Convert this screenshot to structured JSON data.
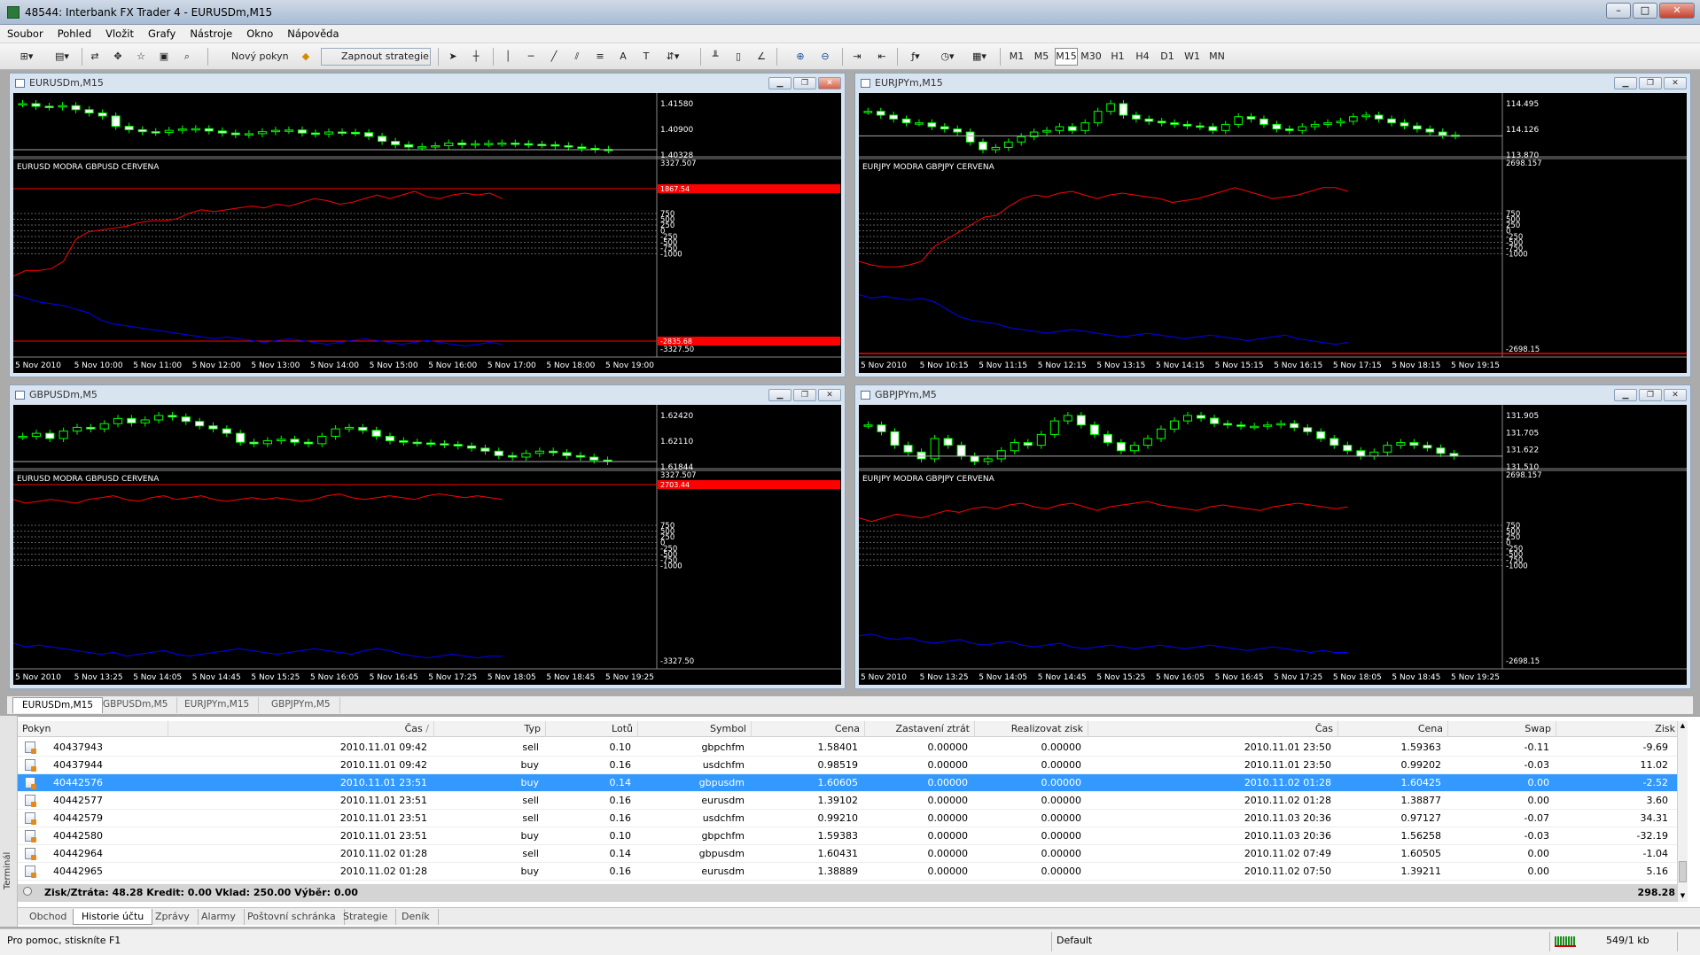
{
  "window": {
    "title": "48544: Interbank FX Trader 4 - EURUSDm,M15",
    "controls": [
      "–",
      "□",
      "✕"
    ]
  },
  "menu": [
    "Soubor",
    "Pohled",
    "Vložit",
    "Grafy",
    "Nástroje",
    "Okno",
    "Nápověda"
  ],
  "toolbar": {
    "new_order": "Nový pokyn",
    "expert": "Zapnout strategie",
    "periods": [
      "M1",
      "M5",
      "M15",
      "M30",
      "H1",
      "H4",
      "D1",
      "W1",
      "MN"
    ],
    "active_period": "M15"
  },
  "charts": [
    {
      "title": "EURUSDm,M15",
      "price_ticks": [
        "1.41580",
        "1.40900",
        "1.40328"
      ],
      "indicator_label": "EURUSD MODRA    GBPUSD CERVENA",
      "indicator_ticks": [
        "3327.507",
        "750",
        "500",
        "250",
        "0",
        "-250",
        "-500",
        "-750",
        "-1000",
        "-3327.50"
      ],
      "red_marker": "1867.54",
      "blue_marker": "-2835.68",
      "time_labels": [
        "5 Nov 2010",
        "5 Nov 10:00",
        "5 Nov 11:00",
        "5 Nov 12:00",
        "5 Nov 13:00",
        "5 Nov 14:00",
        "5 Nov 15:00",
        "5 Nov 16:00",
        "5 Nov 17:00",
        "5 Nov 18:00",
        "5 Nov 19:00"
      ],
      "candles": [
        1.4178,
        1.417,
        1.4168,
        1.4172,
        1.416,
        1.415,
        1.4141,
        1.411,
        1.41,
        1.4094,
        1.4092,
        1.4098,
        1.4102,
        1.4103,
        1.4096,
        1.409,
        1.4085,
        1.4088,
        1.4094,
        1.4098,
        1.4099,
        1.409,
        1.4087,
        1.4093,
        1.4092,
        1.4091,
        1.408,
        1.4065,
        1.4055,
        1.4048,
        1.4049,
        1.4052,
        1.406,
        1.4055,
        1.4058,
        1.4059,
        1.406,
        1.4058,
        1.4056,
        1.4055,
        1.4052,
        1.4048,
        1.4044,
        1.4041,
        1.404
      ],
      "red_line": [
        0.42,
        0.45,
        0.45,
        0.46,
        0.5,
        0.62,
        0.66,
        0.67,
        0.68,
        0.69,
        0.71,
        0.72,
        0.72,
        0.73,
        0.76,
        0.78,
        0.77,
        0.78,
        0.79,
        0.8,
        0.79,
        0.81,
        0.8,
        0.82,
        0.84,
        0.83,
        0.81,
        0.82,
        0.84,
        0.86,
        0.84,
        0.86,
        0.88,
        0.85,
        0.84,
        0.86,
        0.87,
        0.86,
        0.87,
        0.84
      ],
      "blue_line": [
        0.32,
        0.3,
        0.28,
        0.27,
        0.26,
        0.24,
        0.22,
        0.18,
        0.16,
        0.15,
        0.14,
        0.13,
        0.12,
        0.11,
        0.1,
        0.09,
        0.08,
        0.09,
        0.08,
        0.07,
        0.06,
        0.07,
        0.08,
        0.07,
        0.06,
        0.05,
        0.06,
        0.07,
        0.08,
        0.07,
        0.06,
        0.05,
        0.06,
        0.07,
        0.06,
        0.05,
        0.04,
        0.05,
        0.06,
        0.05
      ]
    },
    {
      "title": "EURJPYm,M15",
      "price_ticks": [
        "114.495",
        "114.126",
        "113.870"
      ],
      "indicator_label": "EURJPY MODRA    GBPJPY CERVENA",
      "indicator_ticks": [
        "2698.157",
        "750",
        "500",
        "250",
        "0",
        "-250",
        "-500",
        "-750",
        "-1000",
        "-2698.15"
      ],
      "red_marker": "",
      "blue_marker": "",
      "time_labels": [
        "5 Nov 2010",
        "5 Nov 10:15",
        "5 Nov 11:15",
        "5 Nov 12:15",
        "5 Nov 13:15",
        "5 Nov 14:15",
        "5 Nov 15:15",
        "5 Nov 16:15",
        "5 Nov 17:15",
        "5 Nov 18:15",
        "5 Nov 19:15"
      ],
      "candles": [
        114.45,
        114.4,
        114.35,
        114.3,
        114.3,
        114.25,
        114.22,
        114.18,
        114.05,
        113.95,
        113.98,
        114.05,
        114.12,
        114.18,
        114.2,
        114.25,
        114.2,
        114.3,
        114.45,
        114.55,
        114.4,
        114.35,
        114.32,
        114.3,
        114.28,
        114.26,
        114.25,
        114.2,
        114.28,
        114.38,
        114.35,
        114.28,
        114.22,
        114.2,
        114.25,
        114.28,
        114.3,
        114.32,
        114.38,
        114.4,
        114.35,
        114.3,
        114.26,
        114.22,
        114.18,
        114.14,
        114.13
      ],
      "red_line": [
        0.5,
        0.48,
        0.47,
        0.47,
        0.48,
        0.5,
        0.58,
        0.62,
        0.66,
        0.7,
        0.74,
        0.75,
        0.8,
        0.84,
        0.86,
        0.85,
        0.87,
        0.88,
        0.86,
        0.84,
        0.86,
        0.87,
        0.86,
        0.85,
        0.84,
        0.82,
        0.83,
        0.84,
        0.86,
        0.88,
        0.9,
        0.88,
        0.86,
        0.84,
        0.85,
        0.86,
        0.88,
        0.9,
        0.9,
        0.88
      ],
      "blue_line": [
        0.32,
        0.3,
        0.31,
        0.3,
        0.29,
        0.3,
        0.28,
        0.24,
        0.2,
        0.18,
        0.17,
        0.16,
        0.14,
        0.13,
        0.12,
        0.11,
        0.12,
        0.13,
        0.12,
        0.11,
        0.1,
        0.09,
        0.1,
        0.11,
        0.1,
        0.09,
        0.08,
        0.09,
        0.1,
        0.09,
        0.08,
        0.07,
        0.08,
        0.09,
        0.1,
        0.08,
        0.07,
        0.06,
        0.05,
        0.06
      ]
    },
    {
      "title": "GBPUSDm,M5",
      "price_ticks": [
        "1.62420",
        "1.62110",
        "1.61844"
      ],
      "indicator_label": "EURUSD MODRA    GBPUSD CERVENA",
      "indicator_ticks": [
        "3327.507",
        "750",
        "500",
        "250",
        "0",
        "-250",
        "-500",
        "-750",
        "-1000",
        "-3327.50"
      ],
      "red_marker": "2703.44",
      "blue_marker": "",
      "time_labels": [
        "5 Nov 2010",
        "5 Nov 13:25",
        "5 Nov 14:05",
        "5 Nov 14:45",
        "5 Nov 15:25",
        "5 Nov 16:05",
        "5 Nov 16:45",
        "5 Nov 17:25",
        "5 Nov 18:05",
        "5 Nov 18:45",
        "5 Nov 19:25"
      ],
      "candles": [
        1.6218,
        1.6222,
        1.6215,
        1.6225,
        1.623,
        1.6228,
        1.6235,
        1.6242,
        1.6236,
        1.624,
        1.6246,
        1.6244,
        1.6238,
        1.6232,
        1.6228,
        1.6222,
        1.621,
        1.6208,
        1.6212,
        1.6214,
        1.621,
        1.6208,
        1.6218,
        1.6228,
        1.623,
        1.6226,
        1.6218,
        1.6212,
        1.621,
        1.6209,
        1.6208,
        1.6207,
        1.6205,
        1.6202,
        1.6198,
        1.6192,
        1.619,
        1.6195,
        1.6198,
        1.6196,
        1.6192,
        1.619,
        1.6186,
        1.6184
      ],
      "red_line": [
        0.9,
        0.88,
        0.89,
        0.9,
        0.89,
        0.88,
        0.9,
        0.91,
        0.92,
        0.9,
        0.89,
        0.91,
        0.92,
        0.9,
        0.91,
        0.92,
        0.9,
        0.89,
        0.9,
        0.91,
        0.9,
        0.91,
        0.9,
        0.89,
        0.9,
        0.92,
        0.93,
        0.91,
        0.9,
        0.91,
        0.92,
        0.91,
        0.9,
        0.92,
        0.93,
        0.92,
        0.91,
        0.92,
        0.91,
        0.9
      ],
      "blue_line": [
        0.12,
        0.1,
        0.11,
        0.1,
        0.09,
        0.08,
        0.07,
        0.06,
        0.07,
        0.05,
        0.06,
        0.07,
        0.08,
        0.06,
        0.05,
        0.06,
        0.07,
        0.08,
        0.09,
        0.08,
        0.07,
        0.06,
        0.07,
        0.08,
        0.09,
        0.08,
        0.07,
        0.06,
        0.08,
        0.09,
        0.08,
        0.06,
        0.05,
        0.04,
        0.05,
        0.06,
        0.05,
        0.04,
        0.05,
        0.05
      ]
    },
    {
      "title": "GBPJPYm,M5",
      "price_ticks": [
        "131.905",
        "131.705",
        "131.622",
        "131.510"
      ],
      "indicator_label": "EURJPY MODRA    GBPJPY CERVENA",
      "indicator_ticks": [
        "2698.157",
        "750",
        "500",
        "250",
        "0",
        "-250",
        "-500",
        "-750",
        "-1000",
        "-2698.15"
      ],
      "red_marker": "",
      "blue_marker": "",
      "time_labels": [
        "5 Nov 2010",
        "5 Nov 13:25",
        "5 Nov 14:05",
        "5 Nov 14:45",
        "5 Nov 15:25",
        "5 Nov 16:05",
        "5 Nov 16:45",
        "5 Nov 17:25",
        "5 Nov 18:05",
        "5 Nov 18:45",
        "5 Nov 19:25"
      ],
      "candles": [
        131.85,
        131.8,
        131.7,
        131.65,
        131.6,
        131.75,
        131.7,
        131.62,
        131.58,
        131.6,
        131.66,
        131.72,
        131.7,
        131.78,
        131.88,
        131.92,
        131.85,
        131.78,
        131.72,
        131.66,
        131.7,
        131.75,
        131.82,
        131.88,
        131.92,
        131.9,
        131.86,
        131.85,
        131.84,
        131.84,
        131.85,
        131.86,
        131.83,
        131.8,
        131.75,
        131.7,
        131.66,
        131.62,
        131.65,
        131.7,
        131.72,
        131.7,
        131.68,
        131.64,
        131.62
      ],
      "red_line": [
        0.8,
        0.78,
        0.8,
        0.82,
        0.81,
        0.8,
        0.82,
        0.84,
        0.83,
        0.85,
        0.86,
        0.85,
        0.87,
        0.88,
        0.86,
        0.85,
        0.87,
        0.88,
        0.86,
        0.84,
        0.86,
        0.87,
        0.88,
        0.89,
        0.87,
        0.86,
        0.85,
        0.84,
        0.86,
        0.87,
        0.86,
        0.85,
        0.84,
        0.86,
        0.87,
        0.88,
        0.87,
        0.86,
        0.85,
        0.86
      ],
      "blue_line": [
        0.16,
        0.17,
        0.15,
        0.14,
        0.15,
        0.13,
        0.12,
        0.13,
        0.14,
        0.12,
        0.11,
        0.12,
        0.13,
        0.11,
        0.1,
        0.11,
        0.12,
        0.1,
        0.09,
        0.1,
        0.11,
        0.1,
        0.09,
        0.1,
        0.11,
        0.1,
        0.09,
        0.1,
        0.11,
        0.1,
        0.09,
        0.08,
        0.09,
        0.1,
        0.09,
        0.08,
        0.07,
        0.08,
        0.07,
        0.07
      ]
    }
  ],
  "chart_tabs": [
    "EURUSDm,M15",
    "GBPUSDm,M5",
    "EURJPYm,M15",
    "GBPJPYm,M5"
  ],
  "history": {
    "columns": [
      "Pokyn",
      "Čas",
      "Typ",
      "Lotů",
      "Symbol",
      "Cena",
      "Zastavení ztrát",
      "Realizovat zisk",
      "Čas",
      "Cena",
      "Swap",
      "Zisk"
    ],
    "rows": [
      [
        "40437943",
        "2010.11.01 09:42",
        "sell",
        "0.10",
        "gbpchfm",
        "1.58401",
        "0.00000",
        "0.00000",
        "2010.11.01 23:50",
        "1.59363",
        "-0.11",
        "-9.69"
      ],
      [
        "40437944",
        "2010.11.01 09:42",
        "buy",
        "0.16",
        "usdchfm",
        "0.98519",
        "0.00000",
        "0.00000",
        "2010.11.01 23:50",
        "0.99202",
        "-0.03",
        "11.02"
      ],
      [
        "40442576",
        "2010.11.01 23:51",
        "buy",
        "0.14",
        "gbpusdm",
        "1.60605",
        "0.00000",
        "0.00000",
        "2010.11.02 01:28",
        "1.60425",
        "0.00",
        "-2.52"
      ],
      [
        "40442577",
        "2010.11.01 23:51",
        "sell",
        "0.16",
        "eurusdm",
        "1.39102",
        "0.00000",
        "0.00000",
        "2010.11.02 01:28",
        "1.38877",
        "0.00",
        "3.60"
      ],
      [
        "40442579",
        "2010.11.01 23:51",
        "sell",
        "0.16",
        "usdchfm",
        "0.99210",
        "0.00000",
        "0.00000",
        "2010.11.03 20:36",
        "0.97127",
        "-0.07",
        "34.31"
      ],
      [
        "40442580",
        "2010.11.01 23:51",
        "buy",
        "0.10",
        "gbpchfm",
        "1.59383",
        "0.00000",
        "0.00000",
        "2010.11.03 20:36",
        "1.56258",
        "-0.03",
        "-32.19"
      ],
      [
        "40442964",
        "2010.11.02 01:28",
        "sell",
        "0.14",
        "gbpusdm",
        "1.60431",
        "0.00000",
        "0.00000",
        "2010.11.02 07:49",
        "1.60505",
        "0.00",
        "-1.04"
      ],
      [
        "40442965",
        "2010.11.02 01:28",
        "buy",
        "0.16",
        "eurusdm",
        "1.38889",
        "0.00000",
        "0.00000",
        "2010.11.02 07:50",
        "1.39211",
        "0.00",
        "5.16"
      ]
    ],
    "selected_row": 2,
    "summary": "Zisk/Ztráta: 48.28   Kredit: 0.00   Vklad: 250.00   Výběr: 0.00",
    "total": "298.28"
  },
  "terminal_label": "Terminál",
  "terminal_tabs": [
    "Obchod",
    "Historie účtu",
    "Zprávy",
    "Alarmy",
    "Poštovní schránka",
    "Strategie",
    "Deník"
  ],
  "active_terminal_tab": "Historie účtu",
  "status": {
    "help": "Pro pomoc, stiskníte F1",
    "profile": "Default",
    "traffic": "549/1 kb"
  },
  "colors": {
    "chart_bg": "#000000",
    "bull": "#00FF00",
    "bear": "#FFFFFF",
    "red_line": "#FF0000",
    "blue_line": "#0000FF",
    "selection": "#3399FF"
  }
}
